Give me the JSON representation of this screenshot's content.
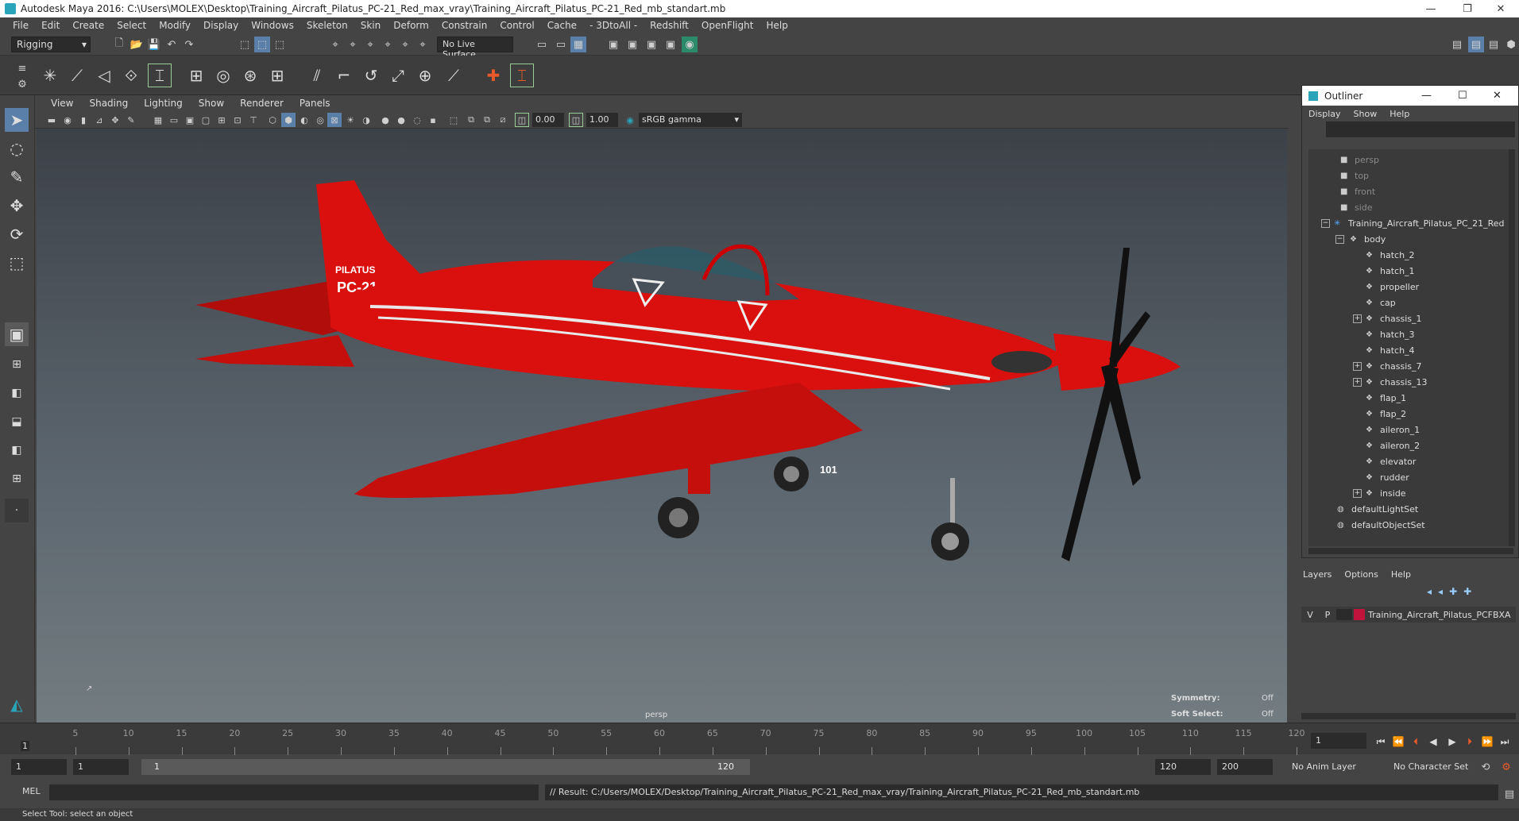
{
  "window": {
    "title": "Autodesk Maya 2016: C:\\Users\\MOLEX\\Desktop\\Training_Aircraft_Pilatus_PC-21_Red_max_vray\\Training_Aircraft_Pilatus_PC-21_Red_mb_standart.mb",
    "minimize": "—",
    "restore": "❐",
    "close": "✕"
  },
  "menubar": [
    "File",
    "Edit",
    "Create",
    "Select",
    "Modify",
    "Display",
    "Windows",
    "Skeleton",
    "Skin",
    "Deform",
    "Constrain",
    "Control",
    "Cache",
    "- 3DtoAll -",
    "Redshift",
    "OpenFlight",
    "Help"
  ],
  "statusline": {
    "mode": "Rigging",
    "live_surface": "No Live Surface"
  },
  "panel": {
    "menus": [
      "View",
      "Shading",
      "Lighting",
      "Show",
      "Renderer",
      "Panels"
    ],
    "exposure": "0.00",
    "gamma": "1.00",
    "colorspace": "sRGB gamma"
  },
  "viewport": {
    "camera_label": "persp",
    "symmetry_label": "Symmetry:",
    "symmetry_value": "Off",
    "soft_select_label": "Soft Select:",
    "soft_select_value": "Off",
    "tail_brand": "PILATUS",
    "tail_model": "PC-21",
    "fuselage_number": "101"
  },
  "outliner": {
    "title": "Outliner",
    "menus": [
      "Display",
      "Show",
      "Help"
    ],
    "items": [
      {
        "label": "persp",
        "dim": true,
        "icon": "camera-icon"
      },
      {
        "label": "top",
        "dim": true,
        "icon": "camera-icon"
      },
      {
        "label": "front",
        "dim": true,
        "icon": "camera-icon"
      },
      {
        "label": "side",
        "dim": true,
        "icon": "camera-icon"
      },
      {
        "label": "Training_Aircraft_Pilatus_PC_21_Red",
        "dim": false,
        "icon": "joint-icon"
      },
      {
        "label": "body",
        "dim": false,
        "icon": "mesh-icon"
      },
      {
        "label": "hatch_2",
        "dim": false,
        "icon": "mesh-icon"
      },
      {
        "label": "hatch_1",
        "dim": false,
        "icon": "mesh-icon"
      },
      {
        "label": "propeller",
        "dim": false,
        "icon": "mesh-icon"
      },
      {
        "label": "cap",
        "dim": false,
        "icon": "mesh-icon"
      },
      {
        "label": "chassis_1",
        "dim": false,
        "icon": "mesh-icon"
      },
      {
        "label": "hatch_3",
        "dim": false,
        "icon": "mesh-icon"
      },
      {
        "label": "hatch_4",
        "dim": false,
        "icon": "mesh-icon"
      },
      {
        "label": "chassis_7",
        "dim": false,
        "icon": "mesh-icon"
      },
      {
        "label": "chassis_13",
        "dim": false,
        "icon": "mesh-icon"
      },
      {
        "label": "flap_1",
        "dim": false,
        "icon": "mesh-icon"
      },
      {
        "label": "flap_2",
        "dim": false,
        "icon": "mesh-icon"
      },
      {
        "label": "aileron_1",
        "dim": false,
        "icon": "mesh-icon"
      },
      {
        "label": "aileron_2",
        "dim": false,
        "icon": "mesh-icon"
      },
      {
        "label": "elevator",
        "dim": false,
        "icon": "mesh-icon"
      },
      {
        "label": "rudder",
        "dim": false,
        "icon": "mesh-icon"
      },
      {
        "label": "inside",
        "dim": false,
        "icon": "mesh-icon"
      },
      {
        "label": "defaultLightSet",
        "dim": false,
        "icon": "set-icon"
      },
      {
        "label": "defaultObjectSet",
        "dim": false,
        "icon": "set-icon"
      }
    ]
  },
  "layers": {
    "menus": [
      "Layers",
      "Options",
      "Help"
    ],
    "row": {
      "v": "V",
      "p": "P",
      "name": "Training_Aircraft_Pilatus_PCFBXA",
      "color": "#c0143c"
    }
  },
  "timeline": {
    "ticks": [
      "5",
      "10",
      "15",
      "20",
      "25",
      "30",
      "35",
      "40",
      "45",
      "50",
      "55",
      "60",
      "65",
      "70",
      "75",
      "80",
      "85",
      "90",
      "95",
      "100",
      "105",
      "110",
      "115",
      "120"
    ],
    "start_marker": "1",
    "current_frame": "1"
  },
  "range": {
    "start": "1",
    "anim_start": "1",
    "range_start": "1",
    "range_end": "120",
    "end": "120",
    "anim_end": "200",
    "anim_layer": "No Anim Layer",
    "character_set": "No Character Set"
  },
  "cmdline": {
    "lang": "MEL",
    "result": "// Result: C:/Users/MOLEX/Desktop/Training_Aircraft_Pilatus_PC-21_Red_max_vray/Training_Aircraft_Pilatus_PC-21_Red_mb_standart.mb"
  },
  "helpline": "Select Tool: select an object",
  "colors": {
    "aircraft": "#d9100e",
    "stripe": "#e8e8e8",
    "accent": "#2aa4b8"
  }
}
